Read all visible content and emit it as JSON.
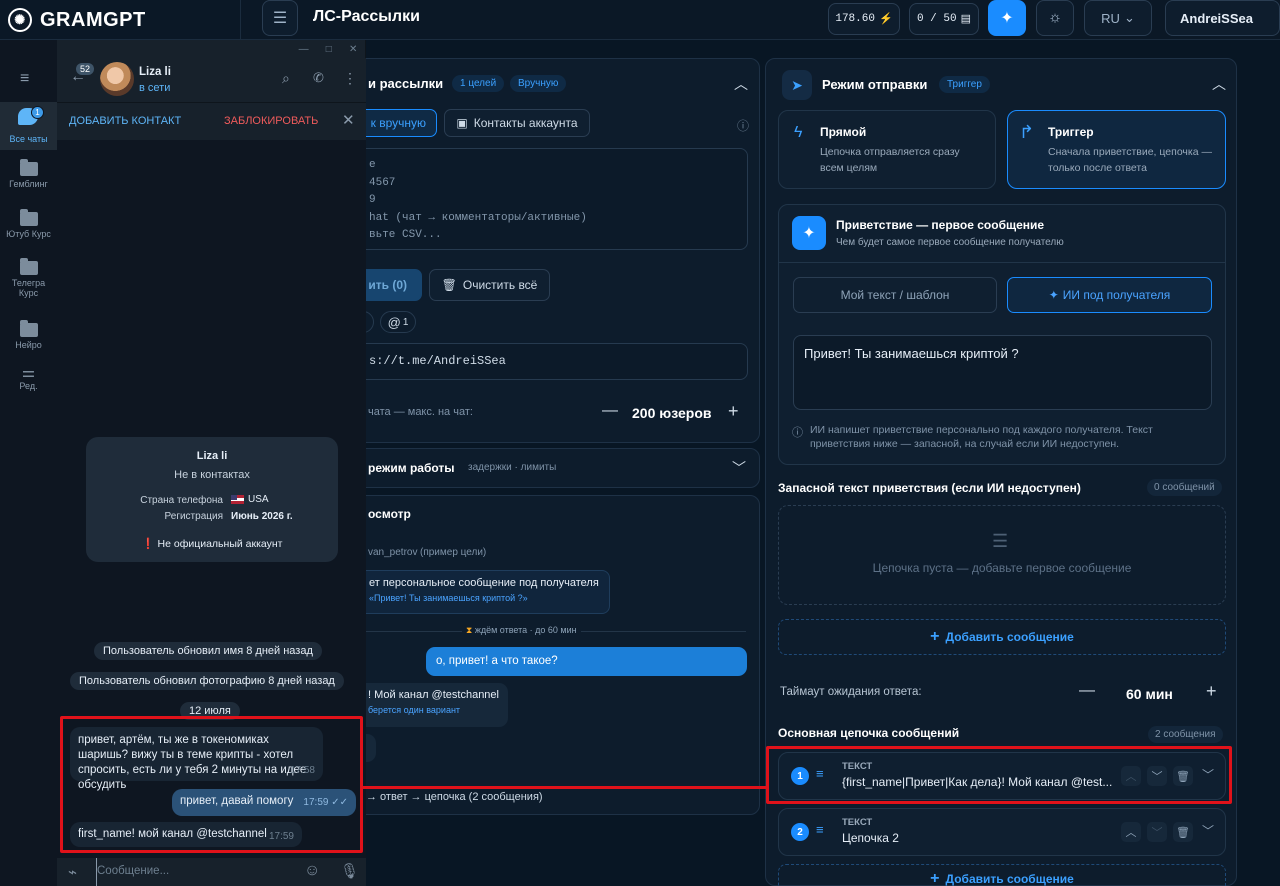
{
  "app": {
    "logo": "GRAMGPT",
    "page_title": "ЛС-Рассылки"
  },
  "topbar": {
    "credits": "178.60",
    "usage": "0 / 50",
    "language": "RU",
    "user": "AndreiSSea"
  },
  "colors": {
    "accent": "#1a8cff",
    "danger": "#e0121a",
    "bg": "#081624"
  },
  "telegram": {
    "window_controls": [
      "—",
      "□",
      "✕"
    ],
    "sidebar": [
      {
        "label": "Все чаты",
        "badge": "1",
        "icon": "chats-icon"
      },
      {
        "label": "Гемблинг",
        "icon": "folder-icon"
      },
      {
        "label": "Ютуб Курс",
        "icon": "folder-icon"
      },
      {
        "label": "Телегра Курс",
        "icon": "folder-icon"
      },
      {
        "label": "Нейро",
        "icon": "folder-icon"
      },
      {
        "label": "Ред.",
        "icon": "sliders-icon"
      }
    ],
    "header": {
      "back_badge": "52",
      "name": "Liza li",
      "status": "в сети"
    },
    "actions": {
      "add": "ДОБАВИТЬ КОНТАКТ",
      "block": "ЗАБЛОКИРОВАТЬ"
    },
    "profile": {
      "name": "Liza li",
      "not_contact": "Не в контактах",
      "country_label": "Страна телефона",
      "country_value": "USA",
      "reg_label": "Регистрация",
      "reg_value": "Июнь 2026 г.",
      "unofficial": "Не официальный аккаунт"
    },
    "service": [
      "Пользователь обновил имя 8 дней назад",
      "Пользователь обновил фотографию 8 дней назад",
      "12 июля"
    ],
    "messages": [
      {
        "text": "привет, артём, ты же в токеномиках шаришь? вижу ты в теме крипты - хотел спросить, есть ли у тебя 2 минуты на идее обсудить",
        "time": "17:58",
        "out": false
      },
      {
        "text": "привет, давай помогу",
        "time": "17:59",
        "out": true
      },
      {
        "text": "first_name! мой канал @testchannel",
        "time": "17:59",
        "out": false
      }
    ],
    "input_placeholder": "Сообщение..."
  },
  "middle": {
    "targets_title": "и рассылки",
    "chip_targets": "1 целей",
    "chip_mode": "Вручную",
    "tab_manual": "к вручную",
    "tab_contacts": "Контакты аккаунта",
    "textarea_lines": [
      "e",
      "4567",
      "9",
      "hat (чат → комментаторы/активные)",
      "вьте CSV..."
    ],
    "add_btn": "ить (0)",
    "clear_btn": "Очистить всё",
    "at_count": "1",
    "link": "s://t.me/AndreiSSea",
    "per_chat_label": "чата — макс. на чат:",
    "per_chat_value": "200 юзеров",
    "work_mode": "режим работы",
    "work_mode_sub": "задержки · лимиты",
    "preview_title": "осмотр",
    "preview_target": "van_petrov",
    "preview_target_note": "(пример цели)",
    "preview_msg1": "ет персональное сообщение под получателя",
    "preview_msg1_sub": "«Привет! Ты занимаешься криптой ?»",
    "wait_note": "ждём ответа · до 60 мин",
    "preview_reply": "о, привет! а что такое?",
    "preview_msg2": "! Мой канал @testchannel",
    "preview_msg2_sub": "берется один вариант",
    "flow": "→ ответ → цепочка (2 сообщения)"
  },
  "right": {
    "mode_title": "Режим отправки",
    "mode_chip": "Триггер",
    "direct_title": "Прямой",
    "direct_desc": "Цепочка отправляется сразу всем целям",
    "trigger_title": "Триггер",
    "trigger_desc": "Сначала приветствие, цепочка — только после ответа",
    "greet_title": "Приветствие — первое сообщение",
    "greet_sub": "Чем будет самое первое сообщение получателю",
    "tab_text": "Мой текст / шаблон",
    "tab_ai": "ИИ под получателя",
    "greet_text": "Привет! Ты занимаешься криптой ?",
    "ai_note": "ИИ напишет приветствие персонально под каждого получателя. Текст приветствия ниже — запасной, на случай если ИИ недоступен.",
    "fallback_title": "Запасной текст приветствия (если ИИ недоступен)",
    "fallback_count": "0 сообщений",
    "empty_chain": "Цепочка пуста — добавьте первое сообщение",
    "add_msg": "Добавить сообщение",
    "timeout_label": "Таймаут ожидания ответа:",
    "timeout_value": "60 мин",
    "chain_title": "Основная цепочка сообщений",
    "chain_count": "2 сообщения",
    "chain": [
      {
        "num": "1",
        "type": "ТЕКСТ",
        "text": "{first_name|Привет|Как дела}! Мой канал @test..."
      },
      {
        "num": "2",
        "type": "ТЕКСТ",
        "text": "Цепочка 2"
      }
    ],
    "add_msg2": "Добавить сообщение"
  }
}
